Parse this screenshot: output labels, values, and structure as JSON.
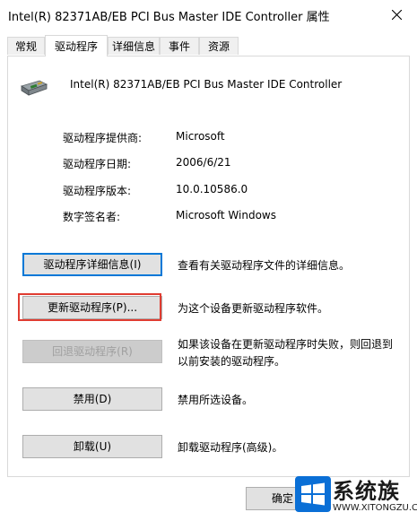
{
  "window": {
    "title": "Intel(R) 82371AB/EB PCI Bus Master IDE Controller 属性"
  },
  "tabs": [
    {
      "label": "常规"
    },
    {
      "label": "驱动程序"
    },
    {
      "label": "详细信息"
    },
    {
      "label": "事件"
    },
    {
      "label": "资源"
    }
  ],
  "active_tab": "驱动程序",
  "device": {
    "name": "Intel(R) 82371AB/EB PCI Bus Master IDE Controller",
    "icon": "ide-controller-icon"
  },
  "properties": [
    {
      "label": "驱动程序提供商:",
      "value": "Microsoft"
    },
    {
      "label": "驱动程序日期:",
      "value": "2006/6/21"
    },
    {
      "label": "驱动程序版本:",
      "value": "10.0.10586.0"
    },
    {
      "label": "数字签名者:",
      "value": "Microsoft Windows"
    }
  ],
  "actions": [
    {
      "button": "驱动程序详细信息(I)",
      "description": "查看有关驱动程序文件的详细信息。"
    },
    {
      "button": "更新驱动程序(P)...",
      "description": "为这个设备更新驱动程序软件。"
    },
    {
      "button": "回退驱动程序(R)",
      "description": "如果该设备在更新驱动程序时失败，则回退到以前安装的驱动程序。"
    },
    {
      "button": "禁用(D)",
      "description": "禁用所选设备。"
    },
    {
      "button": "卸载(U)",
      "description": "卸载驱动程序(高级)。"
    }
  ],
  "footer": {
    "ok_label": "确定"
  },
  "watermark": {
    "text": "系统族",
    "url": "WWW.XITONGZU.COM"
  },
  "colors": {
    "focus": "#0078d7",
    "highlight": "#e03c31",
    "watermark_blue": "#0a6fd6"
  }
}
